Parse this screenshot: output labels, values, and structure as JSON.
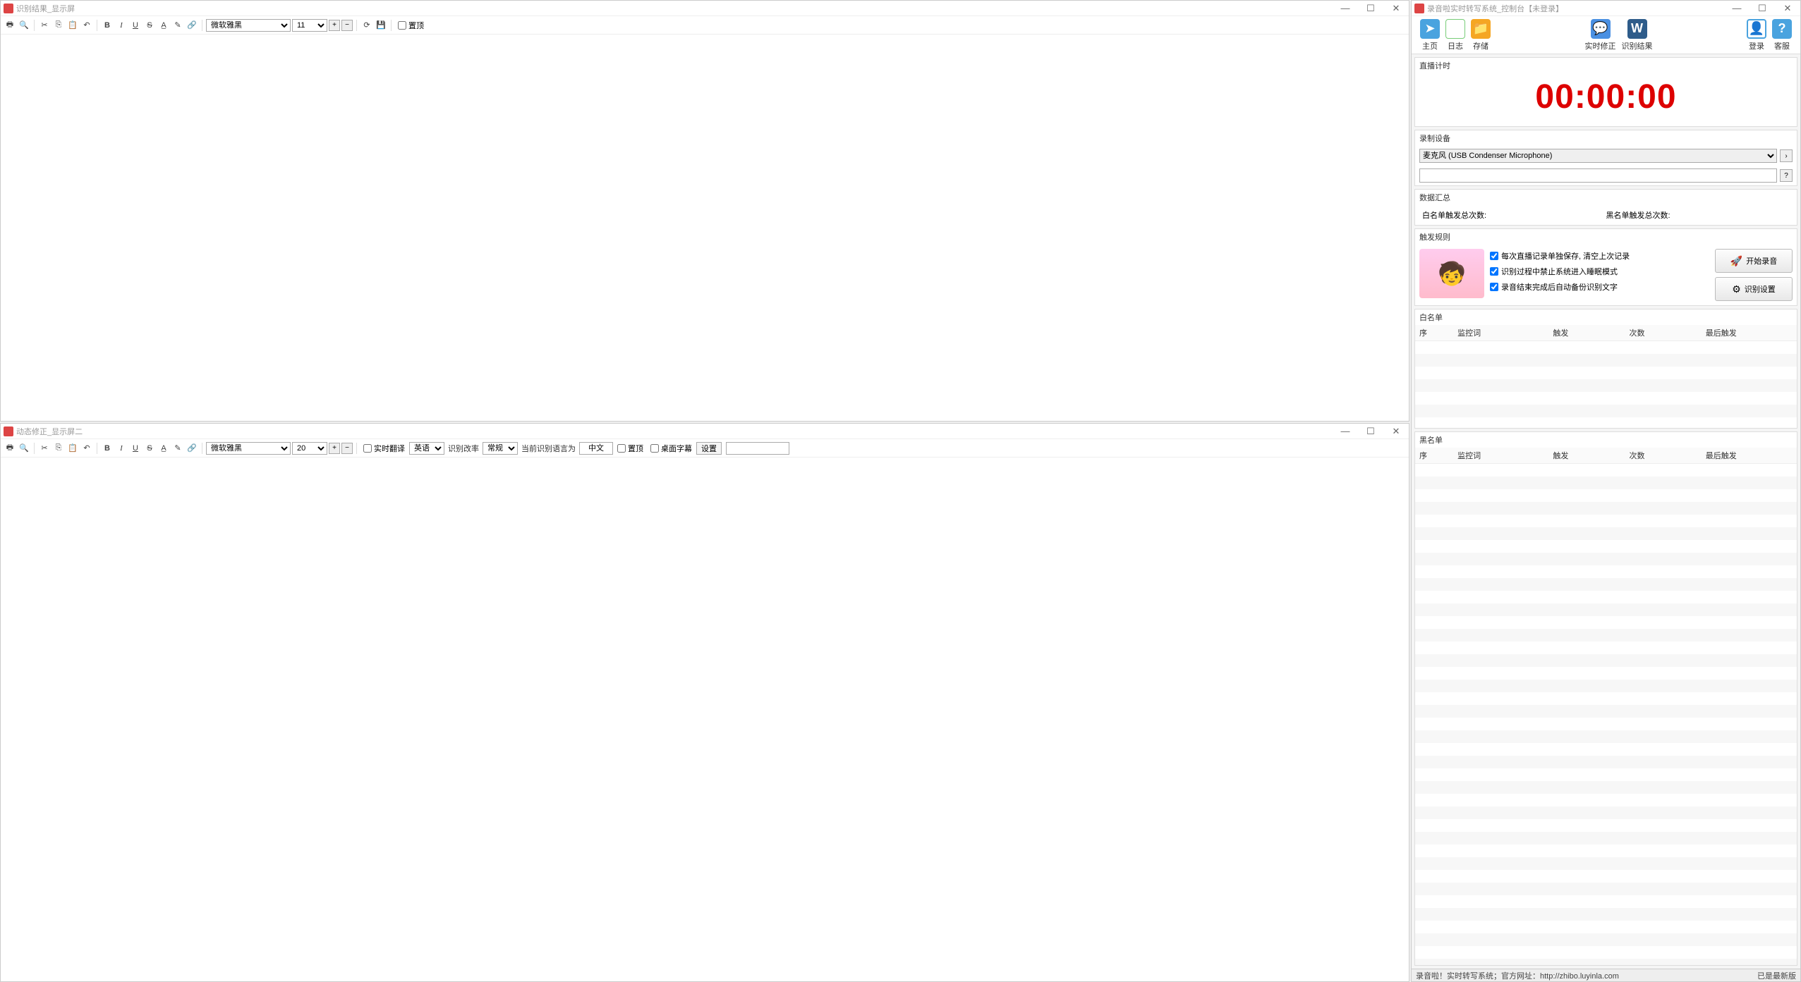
{
  "window1": {
    "title": "识别结果_显示屏",
    "font_name": "微软雅黑",
    "font_size": "11",
    "chk_top": "置顶"
  },
  "window2": {
    "title": "动态修正_显示屏二",
    "font_name": "微软雅黑",
    "font_size": "20",
    "chk_realtime_translate": "实时翻译",
    "lang_src": "英语",
    "rate_label": "识别改率",
    "rate_value": "常规",
    "current_lang_label": "当前识别语言为",
    "current_lang": "中文",
    "chk_top": "置顶",
    "chk_desktop_sub": "桌面字幕",
    "settings": "设置"
  },
  "cp": {
    "title": "录音啦实时转写系统_控制台【未登录】",
    "tools": {
      "home": "主页",
      "log": "日志",
      "save": "存储",
      "realtime": "实时修正",
      "result": "识别结果",
      "login": "登录",
      "help": "客服"
    },
    "timer_section": "直播计时",
    "timer": "00:00:00",
    "device_section": "录制设备",
    "device_selected": "麦克风 (USB Condenser Microphone)",
    "summary_section": "数据汇总",
    "summary": {
      "whitelist_count_label": "白名单触发总次数:",
      "blacklist_count_label": "黑名单触发总次数:"
    },
    "rules_section": "触发规则",
    "rules": {
      "r1": "每次直播记录单独保存, 清空上次记录",
      "r2": "识别过程中禁止系统进入睡眠模式",
      "r3": "录音结束完成后自动备份识别文字"
    },
    "btn_start": "开始录音",
    "btn_settings": "识别设置",
    "whitelist_title": "白名单",
    "blacklist_title": "黑名单",
    "cols": {
      "seq": "序",
      "keyword": "监控词",
      "trigger": "触发",
      "count": "次数",
      "last": "最后触发"
    },
    "status_left": "录音啦！实时转写系统；官方网址：http://zhibo.luyinla.com",
    "status_right": "已是最新版"
  }
}
